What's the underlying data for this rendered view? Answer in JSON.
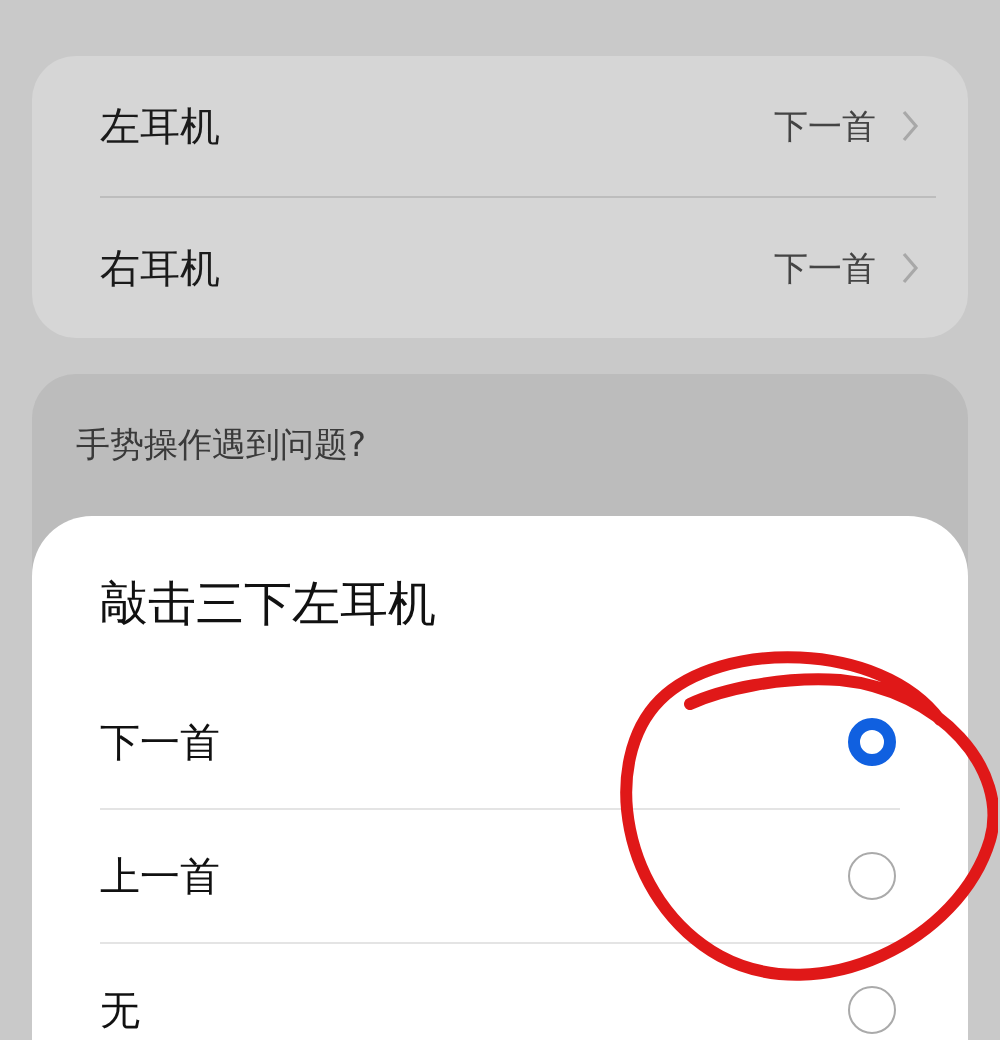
{
  "earbuds": [
    {
      "label": "左耳机",
      "value": "下一首"
    },
    {
      "label": "右耳机",
      "value": "下一首"
    }
  ],
  "help": {
    "question": "手势操作遇到问题?"
  },
  "sheet": {
    "title": "敲击三下左耳机",
    "options": [
      {
        "label": "下一首",
        "selected": true
      },
      {
        "label": "上一首",
        "selected": false
      },
      {
        "label": "无",
        "selected": false
      }
    ]
  }
}
